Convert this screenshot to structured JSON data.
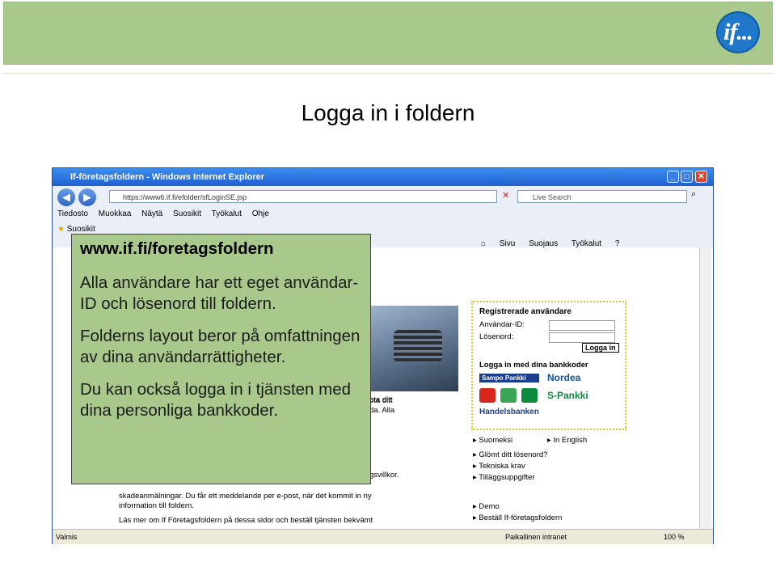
{
  "slide": {
    "title": "Logga in i foldern",
    "logo_text": "if..."
  },
  "browser": {
    "window_title": "If-företagsfoldern - Windows Internet Explorer",
    "address": "https://www6.if.fi/efolder/sfLoginSE.jsp",
    "search_placeholder": "Live Search",
    "menu": [
      "Tiedosto",
      "Muokkaa",
      "Näytä",
      "Suosikit",
      "Työkalut",
      "Ohje"
    ],
    "favorites_label": "Suosikit",
    "toolbar": [
      "Sivu",
      "Suojaus",
      "Työkalut"
    ],
    "status_left": "Valmis",
    "status_zone": "Paikallinen intranet",
    "zoom": "100 %"
  },
  "login": {
    "heading": "Registrerade användare",
    "user_label": "Användar-ID:",
    "password_label": "Lösenord:",
    "login_button": "Logga in",
    "bank_heading": "Logga in med dina bankkoder",
    "sampo": "Sampo Pankki",
    "nordea": "Nordea",
    "spankki": "S-Pankki",
    "handelsbanken": "Handelsbanken"
  },
  "links": {
    "lang_fi": "Suomeksi",
    "lang_en": "In English",
    "forgot": "Glömt ditt lösenord?",
    "tech": "Tekniska krav",
    "additional": "Tilläggsuppgifter",
    "demo": "Demo",
    "order": "Beställ If-företagsfoldern"
  },
  "page_snippets": {
    "snip1": "ota ditt",
    "snip2": "da. Alla",
    "snip3": "gsvillkor.",
    "left1": "skadeanmälningar. Du får ett meddelande per e-post, när det kommit in ny",
    "left2": "information till foldern.",
    "left3": "Läs mer om If Företagsfoldern på dessa sidor och beställ tjänsten bekvämt"
  },
  "callout": {
    "url": "www.if.fi/foretagsfoldern",
    "p1": "Alla användare har ett eget användar-ID och lösenord till foldern.",
    "p2": "Folderns layout beror på omfattningen av dina användarrättigheter.",
    "p3": "Du kan också logga in i tjänsten med dina personliga bankkoder."
  }
}
